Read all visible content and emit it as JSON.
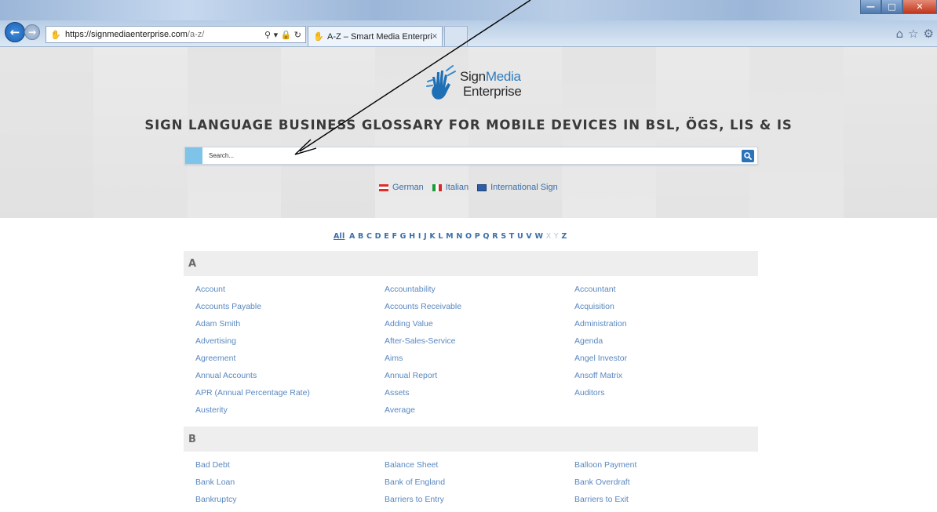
{
  "browser": {
    "url_host": "https://signmediaenterprise.com",
    "url_path": "/a-z/",
    "tab_title": "A-Z – Smart Media Enterpri...",
    "tab_close": "×",
    "search_tool": "⚲ ▾ 🔒 ↻",
    "min": "—",
    "max": "□",
    "close": "✕",
    "back": "←",
    "forward": "→",
    "home_icon": "⌂",
    "star_icon": "☆",
    "gear_icon": "⚙"
  },
  "site": {
    "logo_sign": "Sign",
    "logo_media": "Media",
    "logo_enterprise": "Enterprise",
    "headline": "SIGN LANGUAGE BUSINESS GLOSSARY FOR MOBILE DEVICES IN BSL, ÖGS, LIS & IS",
    "search_placeholder": "Search...",
    "languages": [
      "German",
      "Italian",
      "International Sign"
    ]
  },
  "alphabet": {
    "all": "All",
    "letters": [
      "A",
      "B",
      "C",
      "D",
      "E",
      "F",
      "G",
      "H",
      "I",
      "J",
      "K",
      "L",
      "M",
      "N",
      "O",
      "P",
      "Q",
      "R",
      "S",
      "T",
      "U",
      "V",
      "W",
      "X",
      "Y",
      "Z"
    ],
    "dimmed": [
      "X",
      "Y"
    ]
  },
  "sections": [
    {
      "letter": "A",
      "terms": [
        [
          "Account",
          "Accountability",
          "Accountant"
        ],
        [
          "Accounts Payable",
          "Accounts Receivable",
          "Acquisition"
        ],
        [
          "Adam Smith",
          "Adding Value",
          "Administration"
        ],
        [
          "Advertising",
          "After-Sales-Service",
          "Agenda"
        ],
        [
          "Agreement",
          "Aims",
          "Angel Investor"
        ],
        [
          "Annual Accounts",
          "Annual Report",
          "Ansoff Matrix"
        ],
        [
          "APR (Annual Percentage Rate)",
          "Assets",
          "Auditors"
        ],
        [
          "Austerity",
          "Average",
          ""
        ]
      ]
    },
    {
      "letter": "B",
      "terms": [
        [
          "Bad Debt",
          "Balance Sheet",
          "Balloon Payment"
        ],
        [
          "Bank Loan",
          "Bank of England",
          "Bank Overdraft"
        ],
        [
          "Bankruptcy",
          "Barriers to Entry",
          "Barriers to Exit"
        ]
      ]
    }
  ],
  "colors": {
    "link": "#5a88c0",
    "accent": "#2b72b8",
    "search_accent": "#7ec3e8"
  }
}
